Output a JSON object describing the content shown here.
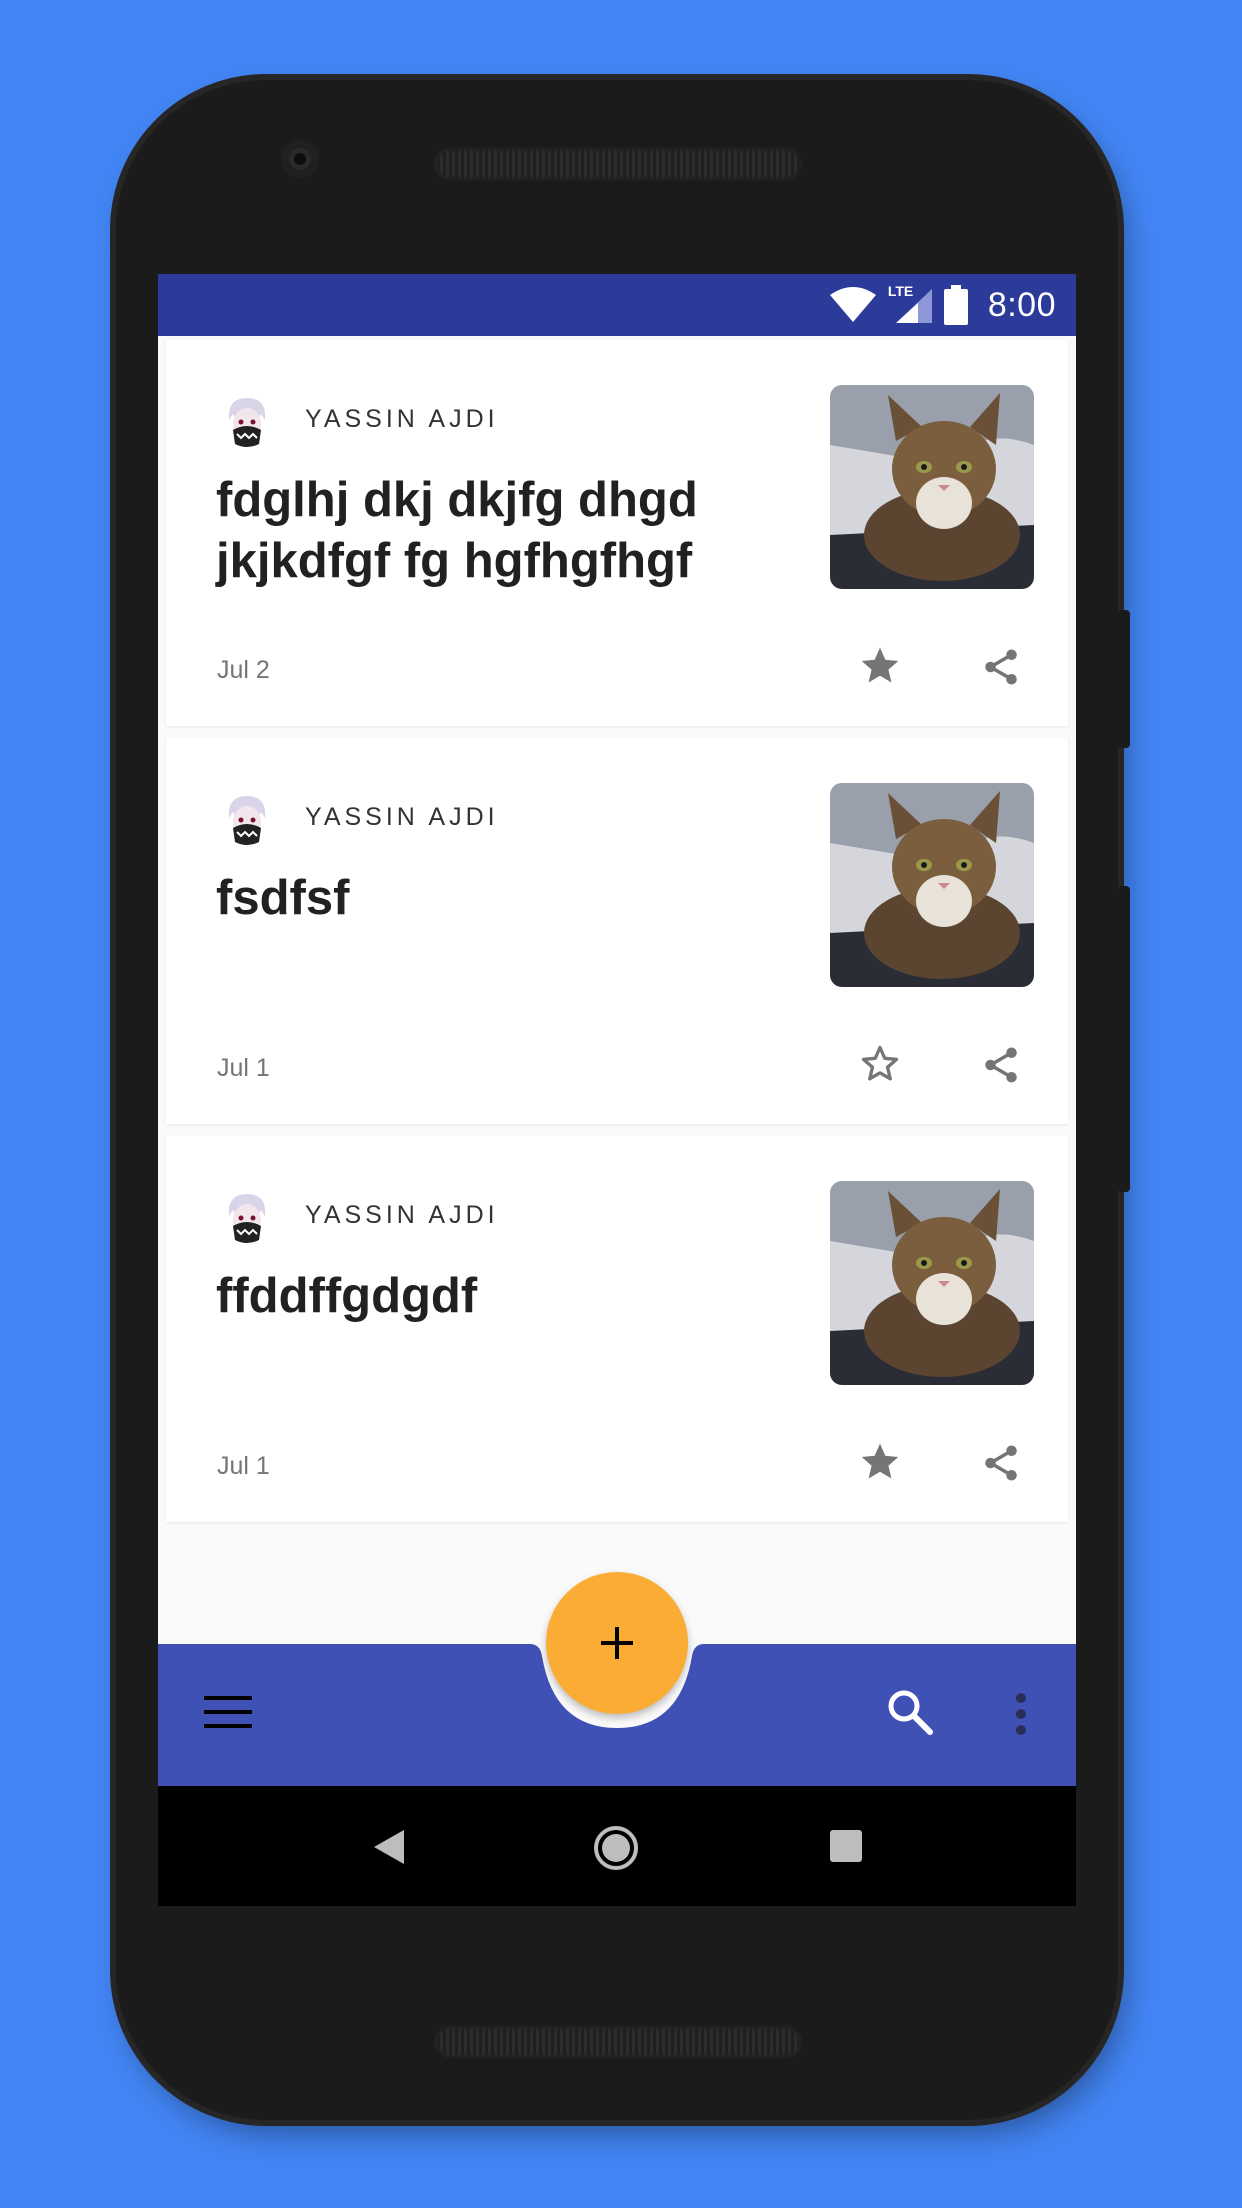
{
  "status_bar": {
    "time": "8:00",
    "network_label": "LTE"
  },
  "posts": [
    {
      "author": "YASSIN AJDI",
      "title": "fdglhj dkj dkjfg dhgd jkjkdfgf fg hgfhgfhgf",
      "date": "Jul 2",
      "starred": true
    },
    {
      "author": "YASSIN AJDI",
      "title": "fsdfsf",
      "date": "Jul 1",
      "starred": false
    },
    {
      "author": "YASSIN AJDI",
      "title": "ffddffgdgdf",
      "date": "Jul 1",
      "starred": true
    }
  ],
  "bottom_bar": {
    "fab_icon": "plus-icon",
    "menu_icon": "menu-icon",
    "search_icon": "search-icon",
    "more_icon": "more-vert-icon"
  },
  "colors": {
    "background": "#4285f4",
    "status_bar": "#2c3a9a",
    "bottom_bar": "#3f51b5",
    "fab": "#fbac34",
    "icon_gray": "#757575"
  }
}
